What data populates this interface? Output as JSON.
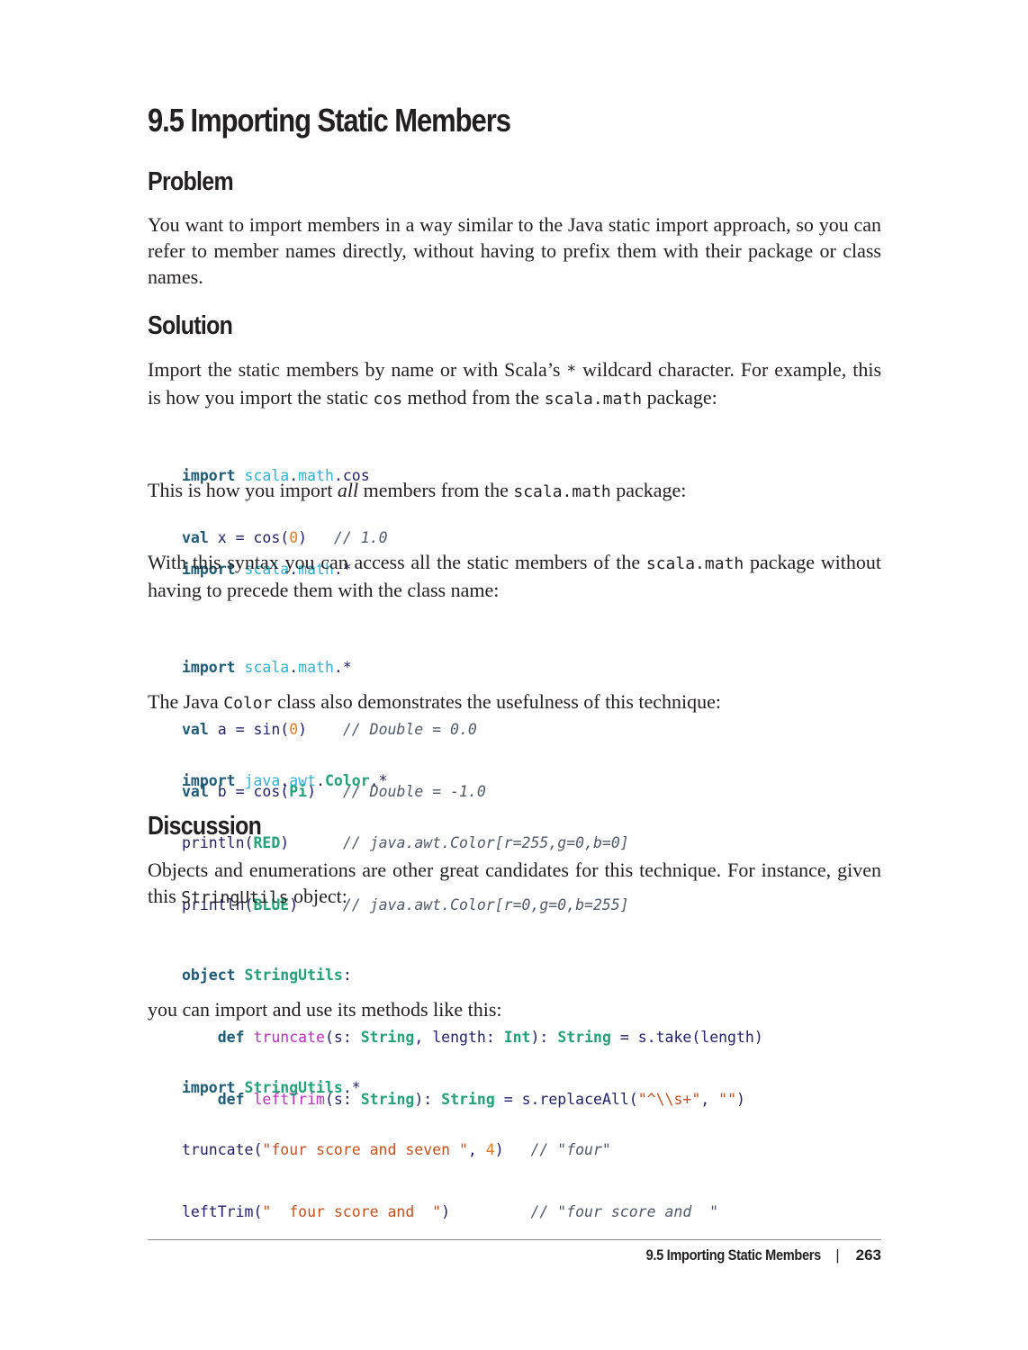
{
  "section_title": "9.5 Importing Static Members",
  "problem": {
    "heading": "Problem",
    "text": "You want to import members in a way similar to the Java static import approach, so you can refer to member names directly, without having to prefix them with their package or class names."
  },
  "solution": {
    "heading": "Solution",
    "para1": {
      "a": "Import the static members by name or with Scala’s ",
      "code1": "*",
      "b": " wildcard character. For example, this is how you import the static ",
      "code2": "cos",
      "c": " method from the ",
      "code3": "scala.math",
      "d": " package:"
    },
    "code1": {
      "l1": {
        "kw": "import",
        "pkg1": "scala",
        "dot1": ".",
        "pkg2": "math",
        "rest": ".cos"
      },
      "l2": {
        "kw": "val",
        "a": " x = cos(",
        "num": "0",
        "b": ")   ",
        "cm": "// 1.0"
      }
    },
    "para2": {
      "a": "This is how you import ",
      "em": "all",
      "b": " members from the ",
      "code": "scala.math",
      "c": " package:"
    },
    "code2": {
      "l1": {
        "kw": "import",
        "pkg1": "scala",
        "dot1": ".",
        "pkg2": "math",
        "rest": ".*"
      }
    },
    "para3": {
      "a": "With this syntax you can access all the static members of the ",
      "code": "scala.math",
      "b": " package without having to precede them with the class name:"
    },
    "code3": {
      "l1": {
        "kw": "import",
        "pkg1": "scala",
        "dot1": ".",
        "pkg2": "math",
        "rest": ".*"
      },
      "l2": {
        "kw": "val",
        "a": " a = sin(",
        "num": "0",
        "b": ")    ",
        "cm": "// Double = 0.0"
      },
      "l3": {
        "kw": "val",
        "a": " b = cos(",
        "ty": "Pi",
        "b": ")   ",
        "cm": "// Double = -1.0"
      }
    },
    "para4": {
      "a": "The Java ",
      "code": "Color",
      "b": " class also demonstrates the usefulness of this technique:"
    },
    "code4": {
      "l1": {
        "kw": "import",
        "pkg1": "java",
        "dot1": ".",
        "pkg2": "awt",
        "dot2": ".",
        "ty": "Color",
        "rest": ".*"
      },
      "l2": {
        "a": "println(",
        "ty": "RED",
        "b": ")      ",
        "cm": "// java.awt.Color[r=255,g=0,b=0]"
      },
      "l3": {
        "a": "println(",
        "ty": "BLUE",
        "b": ")     ",
        "cm": "// java.awt.Color[r=0,g=0,b=255]"
      }
    }
  },
  "discussion": {
    "heading": "Discussion",
    "para1": {
      "a": "Objects and enumerations are other great candidates for this technique. For instance, given this ",
      "code": "StringUtils",
      "b": " object:"
    },
    "code1": {
      "l1": {
        "kw": "object",
        "sp": " ",
        "ty": "StringUtils",
        "rest": ":"
      },
      "l2": {
        "indent": "    ",
        "kw": "def",
        "sp": " ",
        "fn": "truncate",
        "a": "(s: ",
        "ty1": "String",
        "b": ", length: ",
        "ty2": "Int",
        "c": "): ",
        "ty3": "String",
        "d": " = s.take(length)"
      },
      "l3": {
        "indent": "    ",
        "kw": "def",
        "sp": " ",
        "fn": "leftTrim",
        "a": "(s: ",
        "ty1": "String",
        "b": "): ",
        "ty2": "String",
        "c": " = s.replaceAll(",
        "str1": "\"^\\\\s+\"",
        "d": ", ",
        "str2": "\"\"",
        "e": ")"
      }
    },
    "para2": "you can import and use its methods like this:",
    "code2": {
      "l1": {
        "kw": "import",
        "sp": " ",
        "ty": "StringUtils",
        "rest": ".*"
      },
      "l2": {
        "a": "truncate(",
        "str": "\"four score and seven \"",
        "b": ", ",
        "num": "4",
        "c": ")   ",
        "cm": "// \"four\""
      },
      "l3": {
        "a": "leftTrim(",
        "str": "\"  four score and  \"",
        "b": ")         ",
        "cm": "// \"four score and  \""
      }
    }
  },
  "footer": {
    "running_title": "9.5 Importing Static Members",
    "separator": "|",
    "page_number": "263"
  }
}
